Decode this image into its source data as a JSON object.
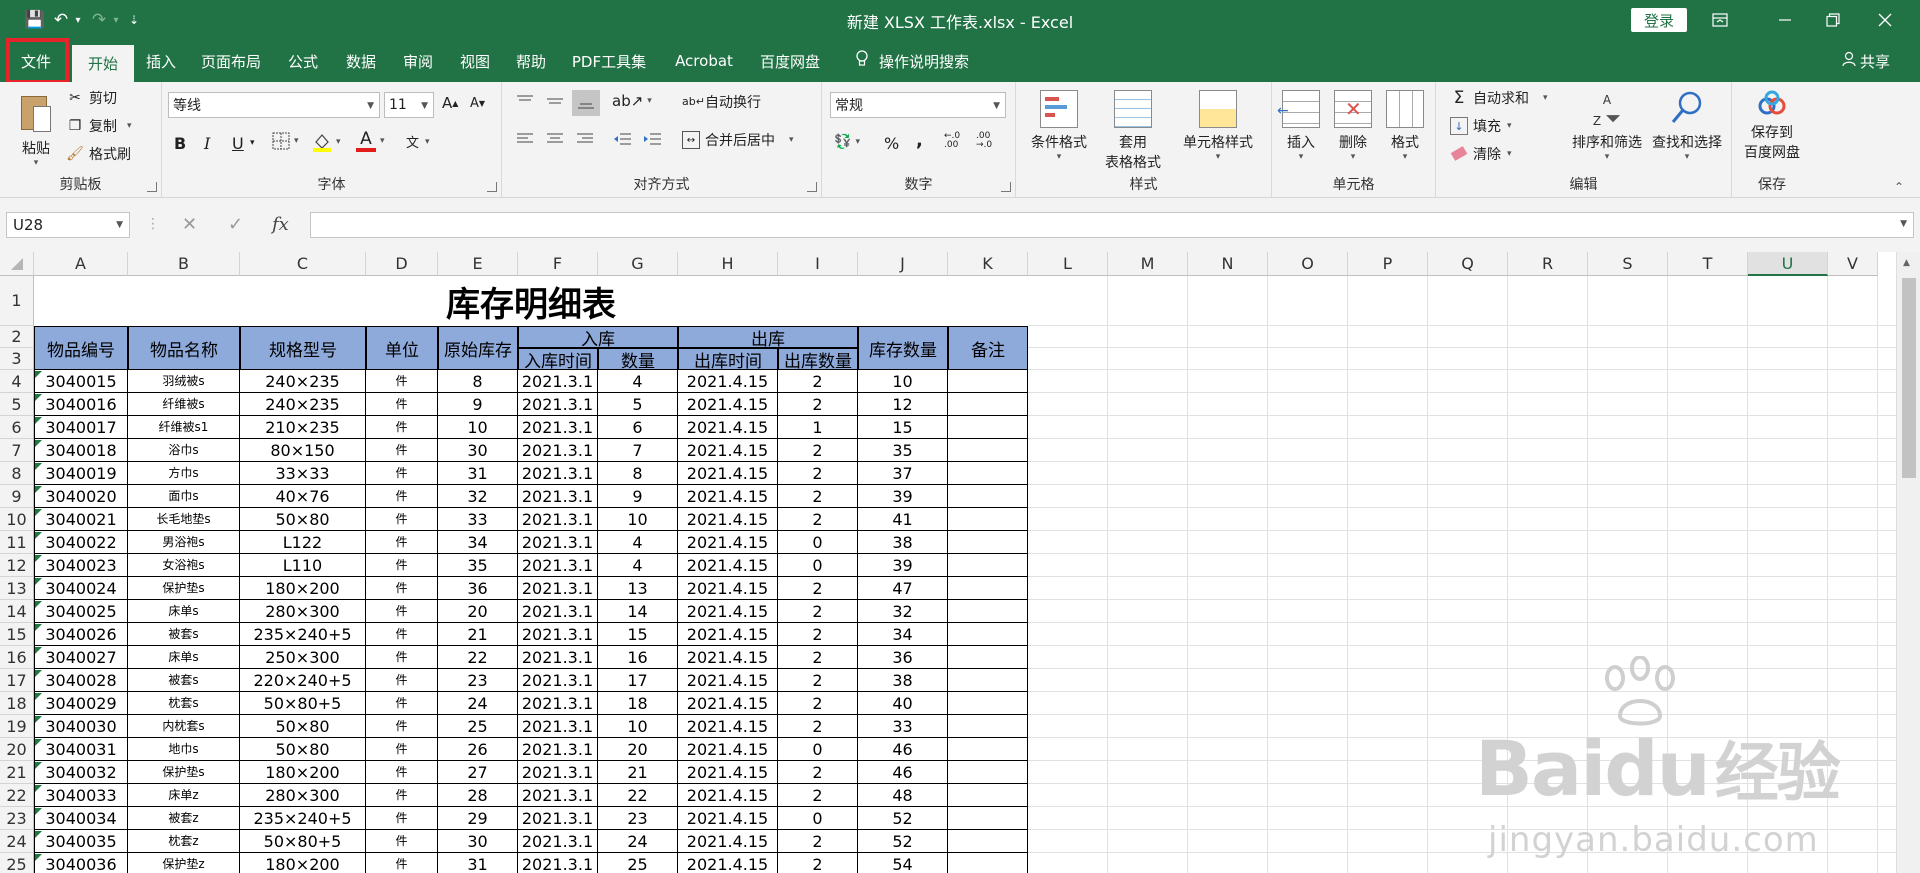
{
  "window": {
    "title": "新建 XLSX 工作表.xlsx  -  Excel",
    "login_label": "登录",
    "share_label": "共享"
  },
  "qat": {
    "save": "💾",
    "undo": "↶",
    "redo": "↷",
    "more": "⇣"
  },
  "tabs": [
    "文件",
    "开始",
    "插入",
    "页面布局",
    "公式",
    "数据",
    "审阅",
    "视图",
    "帮助",
    "PDF工具集",
    "Acrobat",
    "百度网盘",
    "操作说明搜索"
  ],
  "ribbon": {
    "clipboard": {
      "label": "剪贴板",
      "paste": "粘贴",
      "cut": "剪切",
      "copy": "复制",
      "format_painter": "格式刷"
    },
    "font": {
      "label": "字体",
      "font_name": "等线",
      "font_size": "11",
      "bold": "B",
      "italic": "I",
      "underline": "U",
      "grow": "A",
      "shrink": "A"
    },
    "alignment": {
      "label": "对齐方式",
      "wrap": "自动换行",
      "merge": "合并后居中"
    },
    "number": {
      "label": "数字",
      "format": "常规",
      "percent": "%",
      "comma": ","
    },
    "styles": {
      "label": "样式",
      "conditional": "条件格式",
      "table1": "套用",
      "table2": "表格格式",
      "cell_styles": "单元格样式"
    },
    "cells": {
      "label": "单元格",
      "insert": "插入",
      "delete": "删除",
      "format": "格式"
    },
    "editing": {
      "label": "编辑",
      "autosum": "自动求和",
      "fill": "填充",
      "clear": "清除",
      "sort": "排序和筛选",
      "find": "查找和选择"
    },
    "save": {
      "label": "保存",
      "save1": "保存到",
      "save2": "百度网盘"
    }
  },
  "formula_bar": {
    "name_box": "U28",
    "cancel": "✕",
    "enter": "✓",
    "fx": "fx",
    "formula": ""
  },
  "columns": [
    "A",
    "B",
    "C",
    "D",
    "E",
    "F",
    "G",
    "H",
    "I",
    "J",
    "K",
    "L",
    "M",
    "N",
    "O",
    "P",
    "Q",
    "R",
    "S",
    "T",
    "U",
    "V"
  ],
  "rows": [
    "1",
    "2",
    "3",
    "4",
    "5",
    "6",
    "7",
    "8",
    "9",
    "10",
    "11",
    "12",
    "13",
    "14",
    "15",
    "16",
    "17",
    "18",
    "19",
    "20",
    "21",
    "22",
    "23",
    "24",
    "25"
  ],
  "sheet": {
    "title": "库存明细表",
    "headers": {
      "id": "物品编号",
      "name": "物品名称",
      "spec": "规格型号",
      "unit": "单位",
      "orig": "原始库存",
      "in": "入库",
      "in_time": "入库时间",
      "in_qty": "数量",
      "out": "出库",
      "out_time": "出库时间",
      "out_qty": "出库数量",
      "stock": "库存数量",
      "note": "备注"
    },
    "data": [
      [
        "3040015",
        "羽绒被s",
        "240×235",
        "件",
        "8",
        "2021.3.1",
        "4",
        "2021.4.15",
        "2",
        "10"
      ],
      [
        "3040016",
        "纤维被s",
        "240×235",
        "件",
        "9",
        "2021.3.1",
        "5",
        "2021.4.15",
        "2",
        "12"
      ],
      [
        "3040017",
        "纤维被s1",
        "210×235",
        "件",
        "10",
        "2021.3.1",
        "6",
        "2021.4.15",
        "1",
        "15"
      ],
      [
        "3040018",
        "浴巾s",
        "80×150",
        "件",
        "30",
        "2021.3.1",
        "7",
        "2021.4.15",
        "2",
        "35"
      ],
      [
        "3040019",
        "方巾s",
        "33×33",
        "件",
        "31",
        "2021.3.1",
        "8",
        "2021.4.15",
        "2",
        "37"
      ],
      [
        "3040020",
        "面巾s",
        "40×76",
        "件",
        "32",
        "2021.3.1",
        "9",
        "2021.4.15",
        "2",
        "39"
      ],
      [
        "3040021",
        "长毛地垫s",
        "50×80",
        "件",
        "33",
        "2021.3.1",
        "10",
        "2021.4.15",
        "2",
        "41"
      ],
      [
        "3040022",
        "男浴袍s",
        "L122",
        "件",
        "34",
        "2021.3.1",
        "4",
        "2021.4.15",
        "0",
        "38"
      ],
      [
        "3040023",
        "女浴袍s",
        "L110",
        "件",
        "35",
        "2021.3.1",
        "4",
        "2021.4.15",
        "0",
        "39"
      ],
      [
        "3040024",
        "保护垫s",
        "180×200",
        "件",
        "36",
        "2021.3.1",
        "13",
        "2021.4.15",
        "2",
        "47"
      ],
      [
        "3040025",
        "床单s",
        "280×300",
        "件",
        "20",
        "2021.3.1",
        "14",
        "2021.4.15",
        "2",
        "32"
      ],
      [
        "3040026",
        "被套s",
        "235×240+5",
        "件",
        "21",
        "2021.3.1",
        "15",
        "2021.4.15",
        "2",
        "34"
      ],
      [
        "3040027",
        "床单s",
        "250×300",
        "件",
        "22",
        "2021.3.1",
        "16",
        "2021.4.15",
        "2",
        "36"
      ],
      [
        "3040028",
        "被套s",
        "220×240+5",
        "件",
        "23",
        "2021.3.1",
        "17",
        "2021.4.15",
        "2",
        "38"
      ],
      [
        "3040029",
        "枕套s",
        "50×80+5",
        "件",
        "24",
        "2021.3.1",
        "18",
        "2021.4.15",
        "2",
        "40"
      ],
      [
        "3040030",
        "内枕套s",
        "50×80",
        "件",
        "25",
        "2021.3.1",
        "10",
        "2021.4.15",
        "2",
        "33"
      ],
      [
        "3040031",
        "地巾s",
        "50×80",
        "件",
        "26",
        "2021.3.1",
        "20",
        "2021.4.15",
        "0",
        "46"
      ],
      [
        "3040032",
        "保护垫s",
        "180×200",
        "件",
        "27",
        "2021.3.1",
        "21",
        "2021.4.15",
        "2",
        "46"
      ],
      [
        "3040033",
        "床单z",
        "280×300",
        "件",
        "28",
        "2021.3.1",
        "22",
        "2021.4.15",
        "2",
        "48"
      ],
      [
        "3040034",
        "被套z",
        "235×240+5",
        "件",
        "29",
        "2021.3.1",
        "23",
        "2021.4.15",
        "0",
        "52"
      ],
      [
        "3040035",
        "枕套z",
        "50×80+5",
        "件",
        "30",
        "2021.3.1",
        "24",
        "2021.4.15",
        "2",
        "52"
      ],
      [
        "3040036",
        "保护垫z",
        "180×200",
        "件",
        "31",
        "2021.3.1",
        "25",
        "2021.4.15",
        "2",
        "54"
      ]
    ]
  },
  "watermark": {
    "brand": "Bai",
    "brand2": "du",
    "cn": "经验",
    "url": "jingyan.baidu.com"
  },
  "colors": {
    "excel_green": "#217346",
    "header_fill": "#8eaadb",
    "highlight": "#e8242b"
  }
}
